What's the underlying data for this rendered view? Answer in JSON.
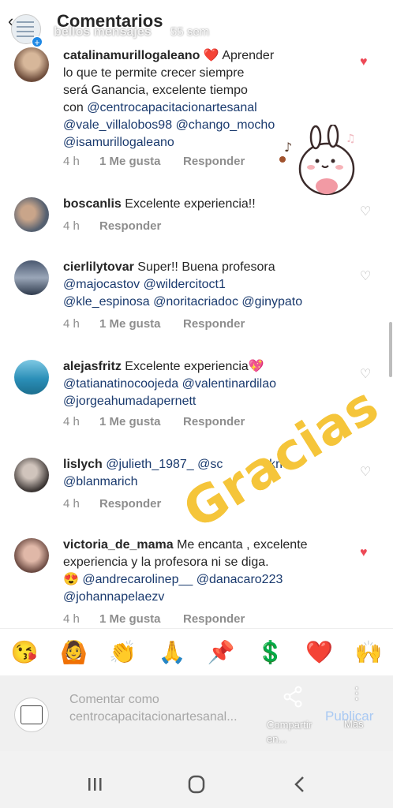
{
  "header": {
    "title": "Comentarios",
    "story_user": "bellos mensajes",
    "story_time": "55 sem"
  },
  "comments": [
    {
      "username": "catalinamurillogaleano",
      "text_a": "❤️ Aprender",
      "text_b": "lo que te permite crecer  siempre",
      "text_c": "será Ganancia, excelente tiempo",
      "text_d": "con ",
      "mention_1": "@centrocapacitacionartesanal",
      "mention_2": "@vale_villalobos98",
      "mention_3": "@chango_mocho",
      "mention_4": "@isamurillogaleano",
      "time": "4 h",
      "likes": "1 Me gusta",
      "reply": "Responder",
      "liked": true
    },
    {
      "username": "boscanlis",
      "text": "Excelente experiencia!!",
      "time": "4 h",
      "reply": "Responder",
      "liked": false
    },
    {
      "username": "cierlilytovar",
      "text": "Super!! Buena profesora",
      "mention_1": "@majocastov",
      "mention_2": "@wildercitoct1",
      "mention_3": "@kle_espinosa",
      "mention_4": "@noritacriadoc",
      "mention_5": "@ginypato",
      "time": "4 h",
      "likes": "1 Me gusta",
      "reply": "Responder",
      "liked": false
    },
    {
      "username": "alejasfritz",
      "text": "Excelente experiencia💖",
      "mention_1": "@tatianatinocoojeda",
      "mention_2": "@valentinardilao",
      "mention_3": "@jorgeahumadapernett",
      "time": "4 h",
      "likes": "1 Me gusta",
      "reply": "Responder",
      "liked": false
    },
    {
      "username": "lislych",
      "mention_1": "@julieth_1987_",
      "mention_2": "@sc",
      "mention_2b": "rkrn",
      "mention_3": "@blanmarich",
      "time": "4 h",
      "reply": "Responder",
      "liked": false
    },
    {
      "username": "victoria_de_mama",
      "text_a": "Me encanta , excelente",
      "text_b": "experiencia y la profesora ni se diga.",
      "emoji": "😍",
      "mention_1": "@andrecarolinep__",
      "mention_2": "@danacaro223",
      "mention_3": "@johannapelaezv",
      "time": "4 h",
      "likes": "1 Me gusta",
      "reply": "Responder",
      "liked": true
    }
  ],
  "overlay_text": "Gracias",
  "emoji_bar": [
    "😘",
    "🙆",
    "👏",
    "🙏",
    "📌",
    "💲",
    "❤️",
    "🙌"
  ],
  "composer": {
    "placeholder": "Comentar como centrocapacitacionartesanal...",
    "share_label": "Compartir en...",
    "publish_label": "Publicar",
    "more_label": "Más"
  },
  "colors": {
    "mention": "#1a3a6e",
    "like_red": "#ed4956",
    "gracias_yellow": "#f5c53a",
    "publish_blue": "#a9c9f3"
  }
}
